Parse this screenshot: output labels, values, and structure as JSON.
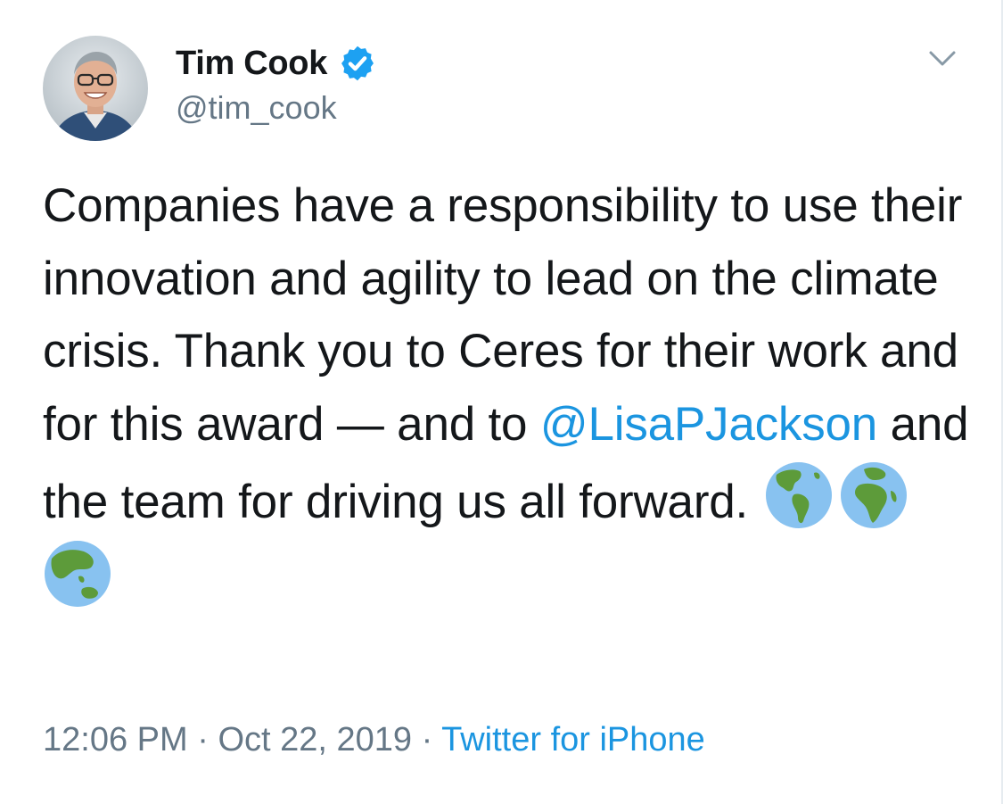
{
  "author": {
    "display_name": "Tim Cook",
    "handle": "@tim_cook",
    "verified": true
  },
  "tweet": {
    "text_before_mention": "Companies have a responsibility to use their innovation and agility to lead on the climate crisis. Thank you to Ceres for their work and for this award — and to ",
    "mention": "@LisaPJackson",
    "text_after_mention": " and the team for driving us all forward.",
    "emojis": [
      "globe-americas-icon",
      "globe-europe-africa-icon",
      "globe-asia-australia-icon"
    ]
  },
  "meta": {
    "time": "12:06 PM",
    "separator": "·",
    "date": "Oct 22, 2019",
    "source": "Twitter for iPhone"
  },
  "colors": {
    "link": "#1b95e0",
    "secondary_text": "#657786",
    "primary_text": "#14171a",
    "verified_badge": "#1da1f2"
  }
}
